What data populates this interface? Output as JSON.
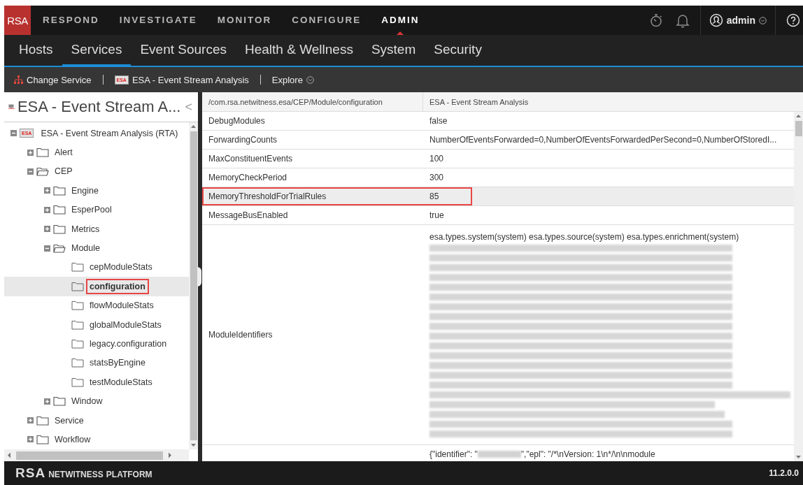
{
  "top_nav": {
    "logo": "RSA",
    "items": [
      {
        "label": "RESPOND",
        "selected": false
      },
      {
        "label": "INVESTIGATE",
        "selected": false
      },
      {
        "label": "MONITOR",
        "selected": false
      },
      {
        "label": "CONFIGURE",
        "selected": false
      },
      {
        "label": "ADMIN",
        "selected": true
      }
    ],
    "user": "admin"
  },
  "sub_nav": [
    {
      "label": "Hosts",
      "selected": false
    },
    {
      "label": "Services",
      "selected": true
    },
    {
      "label": "Event Sources",
      "selected": false
    },
    {
      "label": "Health & Wellness",
      "selected": false
    },
    {
      "label": "System",
      "selected": false
    },
    {
      "label": "Security",
      "selected": false
    }
  ],
  "toolbar": {
    "change_service": "Change Service",
    "service_badge": "ESA",
    "service": "ESA - Event Stream Analysis",
    "explore": "Explore"
  },
  "tree_panel": {
    "title": "ESA - Event Stream A...",
    "collapse": "<",
    "tree": [
      {
        "label": "ESA - Event Stream Analysis (RTA)",
        "kind": "service",
        "badge": "ESA",
        "expanded": true,
        "selected": false,
        "outlined": false,
        "children": [
          {
            "label": "Alert",
            "kind": "folder",
            "expanded": false,
            "selected": false,
            "outlined": false
          },
          {
            "label": "CEP",
            "kind": "folder",
            "expanded": true,
            "selected": false,
            "outlined": false,
            "children": [
              {
                "label": "Engine",
                "kind": "folder",
                "expanded": false,
                "selected": false,
                "outlined": false
              },
              {
                "label": "EsperPool",
                "kind": "folder",
                "expanded": false,
                "selected": false,
                "outlined": false
              },
              {
                "label": "Metrics",
                "kind": "folder",
                "expanded": false,
                "selected": false,
                "outlined": false
              },
              {
                "label": "Module",
                "kind": "folder",
                "expanded": true,
                "selected": false,
                "outlined": false,
                "children": [
                  {
                    "label": "cepModuleStats",
                    "kind": "leaf",
                    "selected": false,
                    "outlined": false
                  },
                  {
                    "label": "configuration",
                    "kind": "leaf",
                    "selected": true,
                    "outlined": true
                  },
                  {
                    "label": "flowModuleStats",
                    "kind": "leaf",
                    "selected": false,
                    "outlined": false
                  },
                  {
                    "label": "globalModuleStats",
                    "kind": "leaf",
                    "selected": false,
                    "outlined": false
                  },
                  {
                    "label": "legacy.configuration",
                    "kind": "leaf",
                    "selected": false,
                    "outlined": false
                  },
                  {
                    "label": "statsByEngine",
                    "kind": "leaf",
                    "selected": false,
                    "outlined": false
                  },
                  {
                    "label": "testModuleStats",
                    "kind": "leaf",
                    "selected": false,
                    "outlined": false
                  }
                ]
              },
              {
                "label": "Window",
                "kind": "folder",
                "expanded": false,
                "selected": false,
                "outlined": false
              }
            ]
          },
          {
            "label": "Service",
            "kind": "folder",
            "expanded": false,
            "selected": false,
            "outlined": false
          },
          {
            "label": "Workflow",
            "kind": "folder",
            "expanded": false,
            "selected": false,
            "outlined": false
          }
        ]
      }
    ]
  },
  "table": {
    "columns": [
      "/com.rsa.netwitness.esa/CEP/Module/configuration",
      "ESA - Event Stream Analysis"
    ],
    "rows": [
      {
        "name": "DebugModules",
        "value": "false",
        "kind": "plain",
        "selected": false,
        "outlined": false
      },
      {
        "name": "ForwardingCounts",
        "value": "NumberOfEventsForwarded=0,NumberOfEventsForwardedPerSecond=0,NumberOfStoredI...",
        "kind": "plain",
        "selected": false,
        "outlined": false
      },
      {
        "name": "MaxConstituentEvents",
        "value": "100",
        "kind": "plain",
        "selected": false,
        "outlined": false
      },
      {
        "name": "MemoryCheckPeriod",
        "value": "300",
        "kind": "plain",
        "selected": false,
        "outlined": false
      },
      {
        "name": "MemoryThresholdForTrialRules",
        "value": "85",
        "kind": "plain",
        "selected": true,
        "outlined": true
      },
      {
        "name": "MessageBusEnabled",
        "value": "true",
        "kind": "plain",
        "selected": false,
        "outlined": false
      },
      {
        "name": "ModuleIdentifiers",
        "value": "esa.types.system(system) esa.types.source(system) esa.types.enrichment(system)",
        "kind": "redacted_list",
        "selected": false,
        "outlined": false
      },
      {
        "value": "{\"identifier\": \"",
        "value_after": "\",\"epl\": \"/*\\nVersion: 1\\n*/\\n\\nmodule",
        "kind": "redacted_inline",
        "selected": false,
        "outlined": false
      }
    ]
  },
  "footer": {
    "brand": "RSA",
    "product": "NETWITNESS",
    "product_suffix": "PLATFORM",
    "version": "11.2.0.0"
  }
}
